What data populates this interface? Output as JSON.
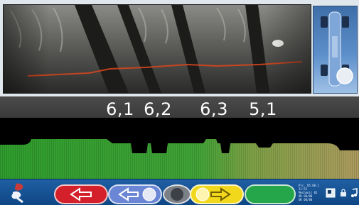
{
  "camera": {
    "label": "tire-tread-camera-view"
  },
  "tread_readings": {
    "unit": "mm",
    "values": [
      "6,1",
      "6,2",
      "6,3",
      "5,1"
    ]
  },
  "toolbar": {
    "buttons": [
      {
        "name": "back",
        "color": "#d4202a",
        "icon": "arrow-left-icon"
      },
      {
        "name": "previous",
        "color": "#6a86d4",
        "icon": "arrow-left-icon"
      },
      {
        "name": "neutral",
        "color": "#7b7f86",
        "icon": "circle-icon"
      },
      {
        "name": "forward",
        "color": "#f2d81c",
        "icon": "arrow-right-icon"
      },
      {
        "name": "confirm",
        "color": "#25a64a",
        "icon": "none"
      }
    ],
    "status_lines": [
      "Prc. 85.08.1",
      "11:55",
      "Mechanic 01",
      "OK 00/00",
      "OK 00/00"
    ]
  },
  "colors": {
    "profile_green": "#2e9a2c",
    "profile_olive": "#a89a5b",
    "band_dark": "#3f3f3f",
    "toolbar_blue": "#175594"
  }
}
